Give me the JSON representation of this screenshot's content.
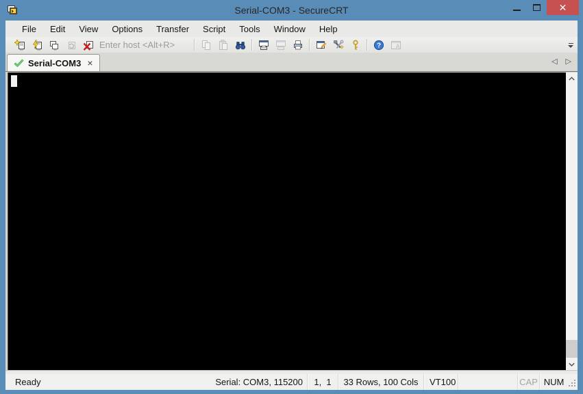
{
  "window": {
    "title": "Serial-COM3 - SecureCRT",
    "close_glyph": "✕"
  },
  "colors": {
    "frame_blue": "#5a8cb8",
    "close_red": "#c75050",
    "menubar_bg": "#e9e9e7",
    "terminal_bg": "#000000",
    "cursor": "#f2f2f2",
    "tab_check_green": "#3fae49"
  },
  "menu": {
    "items": [
      "File",
      "Edit",
      "View",
      "Options",
      "Transfer",
      "Script",
      "Tools",
      "Window",
      "Help"
    ]
  },
  "toolbar": {
    "host_placeholder": "Enter host <Alt+R>",
    "icons": [
      "connect-icon",
      "quick-connect-icon",
      "connect-in-tab-icon",
      "reconnect-icon",
      "disconnect-icon",
      "copy-icon",
      "paste-icon",
      "find-icon",
      "print-screen-icon",
      "print-selection-icon",
      "printer-icon",
      "session-options-icon",
      "global-options-icon",
      "key-icon",
      "help-icon",
      "command-window-icon",
      "chevron-down-icon"
    ]
  },
  "tabbar": {
    "active_tab": "Serial-COM3",
    "close_glyph": "×",
    "nav_left": "◁",
    "nav_right": "▷"
  },
  "status": {
    "ready": "Ready",
    "serial": "Serial: COM3, 115200",
    "cursor_pos": "1,  1",
    "grid": "33 Rows, 100 Cols",
    "emulation": "VT100",
    "cap": "CAP",
    "num": "NUM"
  }
}
